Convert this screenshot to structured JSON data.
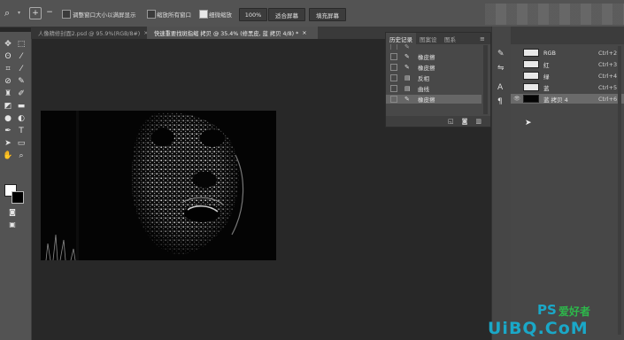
{
  "options_bar": {
    "resize_windows_label": "调整窗口大小以满屏显示",
    "zoom_all_label": "缩放所有窗口",
    "scrubby_zoom_label": "细微缩放",
    "zoom_value": "100%",
    "fit_screen_label": "适合屏幕",
    "fill_screen_label": "填充屏幕"
  },
  "tabs": [
    {
      "label": "人像精修封面2.psd @ 95.9%(RGB/8#)",
      "close": "×"
    },
    {
      "label": "快速重要找斑指缩 拷贝 @ 35.4% (修黑皮, 蓝 拷贝 4/8) *",
      "close": "×"
    }
  ],
  "history": {
    "tabs": [
      "历史记录",
      "图案设",
      "图系"
    ],
    "items": [
      {
        "label": "橡皮擦",
        "icon": "brush-icon",
        "selected": false
      },
      {
        "label": "橡皮擦",
        "icon": "brush-icon",
        "selected": false
      },
      {
        "label": "反相",
        "icon": "document-icon",
        "selected": false
      },
      {
        "label": "曲线",
        "icon": "document-icon",
        "selected": false
      },
      {
        "label": "橡皮擦",
        "icon": "brush-icon",
        "selected": true
      }
    ]
  },
  "channels": [
    {
      "name": "RGB",
      "shortcut": "Ctrl+2",
      "selected": false
    },
    {
      "name": "红",
      "shortcut": "Ctrl+3",
      "selected": false
    },
    {
      "name": "绿",
      "shortcut": "Ctrl+4",
      "selected": false
    },
    {
      "name": "蓝",
      "shortcut": "Ctrl+5",
      "selected": false
    },
    {
      "name": "蓝 拷贝 4",
      "shortcut": "Ctrl+6",
      "selected": true
    }
  ],
  "watermark": {
    "ps": "PS",
    "cn": "爱好者",
    "url": "UiBQ.CoM"
  },
  "colors": {
    "accent_cyan": "#1aa8c8",
    "accent_green": "#2db84b",
    "options_bg": "#535353",
    "canvas_bg": "#282828"
  }
}
